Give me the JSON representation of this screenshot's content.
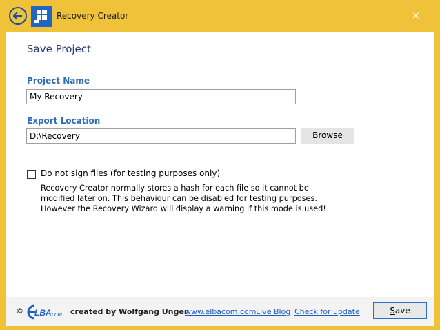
{
  "titlebar": {
    "title": "Recovery Creator",
    "close_glyph": "×",
    "back_icon": "back-arrow-icon",
    "logo_icon": "windows-logo-icon"
  },
  "page": {
    "title": "Save Project"
  },
  "form": {
    "project_name_label": "Project Name",
    "project_name_value": "My Recovery",
    "export_location_label": "Export Location",
    "export_location_value": "D:\\Recovery",
    "browse_mnemonic": "B",
    "browse_rest": "rowse",
    "sign_checkbox_checked": false,
    "sign_mnemonic": "D",
    "sign_rest": "o not sign files (for testing purposes only)",
    "description_lines": [
      "Recovery Creator normally stores a hash for each file so it cannot be",
      "modified later on. This behaviour can be disabled for testing purposes.",
      "However the Recovery Wizard will display a warning if this mode is used!"
    ]
  },
  "footer": {
    "copyright": "©",
    "logo_text_main": "LBA",
    "logo_text_suffix": "com",
    "created_by": "created by Wolfgang Unger",
    "links": {
      "website": "www.elbacom.com",
      "blog": "Live Blog",
      "update": "Check for update"
    },
    "save_mnemonic": "S",
    "save_rest": "ave"
  },
  "colors": {
    "titlebar_bg": "#f0c23a",
    "accent_blue": "#1f66c7",
    "label_blue": "#2f6db5",
    "link_blue": "#1c5fbf"
  }
}
